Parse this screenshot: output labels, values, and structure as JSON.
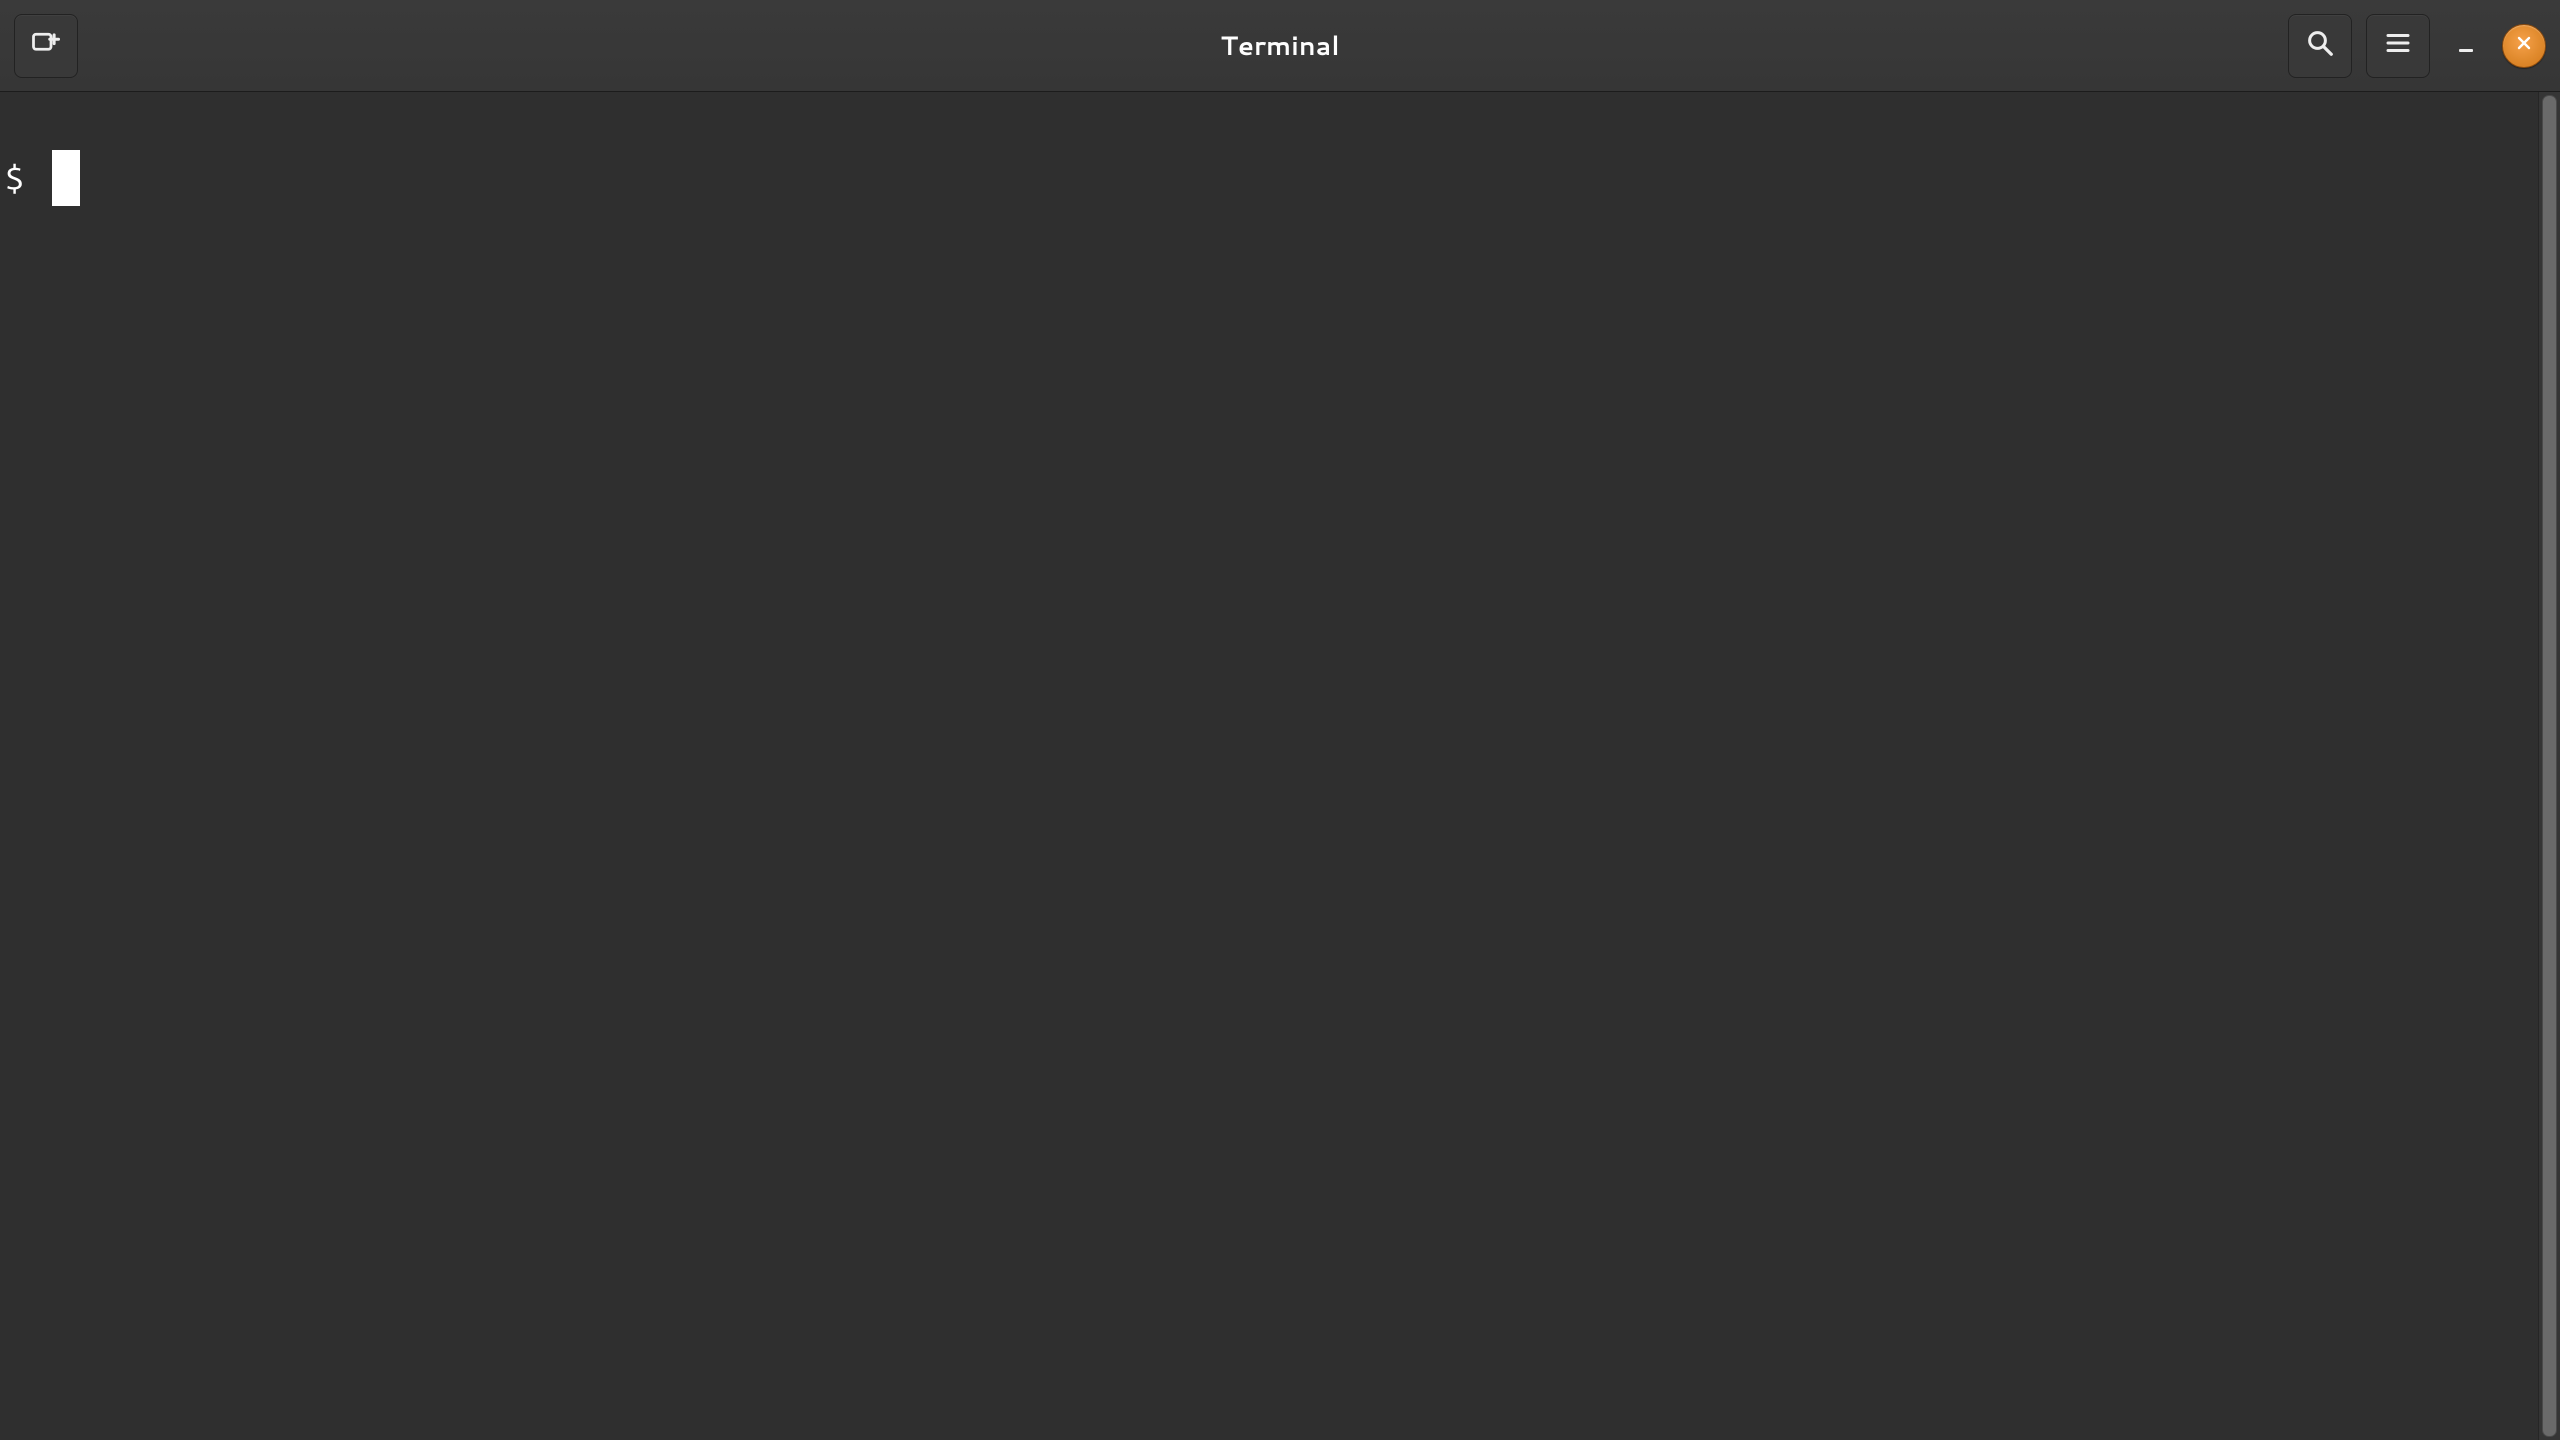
{
  "titlebar": {
    "title": "Terminal",
    "new_tab_icon": "new-tab-icon",
    "search_icon": "search-icon",
    "menu_icon": "hamburger-menu-icon",
    "minimize_icon": "minimize-icon",
    "close_icon": "close-icon"
  },
  "terminal": {
    "prompt": "$",
    "input": ""
  },
  "colors": {
    "background": "#2f2f2f",
    "titlebar": "#373737",
    "text": "#ffffff",
    "close_button": "#e08a2d"
  }
}
